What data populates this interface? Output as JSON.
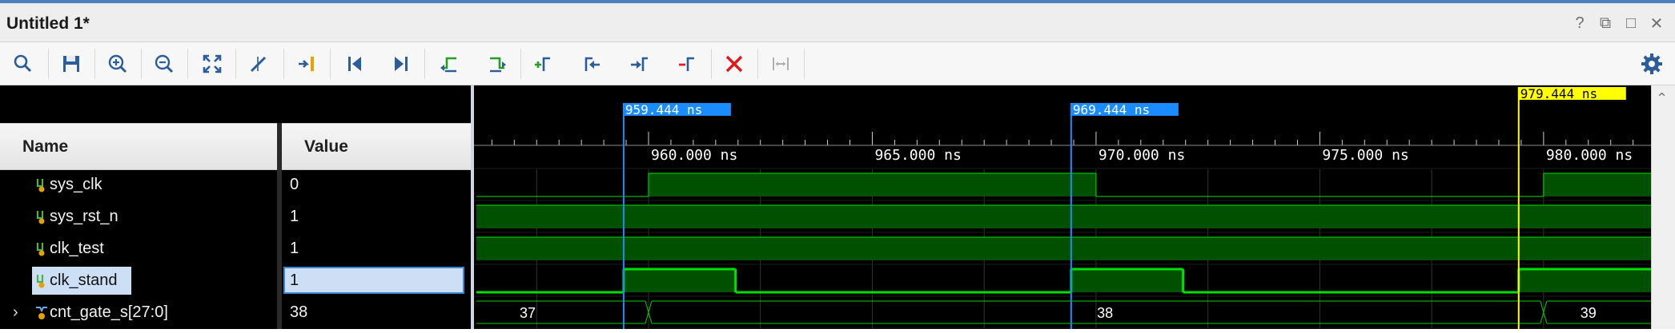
{
  "window": {
    "title": "Untitled 1*",
    "controls": [
      {
        "name": "help-icon",
        "glyph": "?"
      },
      {
        "name": "restore-icon",
        "glyph": "⧉"
      },
      {
        "name": "maximize-icon",
        "glyph": "□"
      },
      {
        "name": "close-icon",
        "glyph": "✕"
      }
    ]
  },
  "toolbar": {
    "buttons": [
      {
        "name": "search-icon"
      },
      {
        "name": "save-icon"
      },
      {
        "name": "zoom-in-icon"
      },
      {
        "name": "zoom-out-icon"
      },
      {
        "name": "zoom-fit-icon"
      },
      {
        "name": "cursor-snap-icon"
      },
      {
        "name": "goto-cursor-icon"
      },
      {
        "name": "goto-start-icon"
      },
      {
        "name": "goto-end-icon"
      },
      {
        "name": "prev-transition-icon"
      },
      {
        "name": "next-transition-icon"
      },
      {
        "name": "add-marker-icon"
      },
      {
        "name": "prev-marker-icon"
      },
      {
        "name": "next-marker-icon"
      },
      {
        "name": "remove-marker-icon"
      },
      {
        "name": "delete-icon"
      },
      {
        "name": "swap-cursors-icon"
      }
    ],
    "settings_icon": "gear-icon"
  },
  "columns": {
    "name": "Name",
    "value": "Value"
  },
  "signals": [
    {
      "name": "sys_clk",
      "value": "0",
      "type": "bit"
    },
    {
      "name": "sys_rst_n",
      "value": "1",
      "type": "bit"
    },
    {
      "name": "clk_test",
      "value": "1",
      "type": "bit"
    },
    {
      "name": "clk_stand",
      "value": "1",
      "type": "bit",
      "selected": true
    },
    {
      "name": "cnt_gate_s[27:0]",
      "value": "38",
      "type": "bus",
      "expandable": true
    }
  ],
  "waveform": {
    "cursors": [
      {
        "label": "959.444 ns",
        "time": 959.444,
        "color": "#1a8cff"
      },
      {
        "label": "969.444 ns",
        "time": 969.444,
        "color": "#1a8cff"
      },
      {
        "label": "979.444 ns",
        "time": 979.444,
        "color": "#ffff00"
      }
    ],
    "ticks": [
      {
        "label": "960.000 ns",
        "time": 960
      },
      {
        "label": "965.000 ns",
        "time": 965
      },
      {
        "label": "970.000 ns",
        "time": 970
      },
      {
        "label": "975.000 ns",
        "time": 975
      },
      {
        "label": "980.000 ns",
        "time": 980
      }
    ],
    "time_range": [
      956.1,
      982.4
    ],
    "bus_labels": [
      {
        "text": "37",
        "time": 957.3
      },
      {
        "text": "38",
        "time": 970.2
      },
      {
        "text": "39",
        "time": 981.0
      }
    ],
    "colors": {
      "high_fill": "#005000",
      "line": "#00e000",
      "bus_line": "#00d000",
      "grid": "#333333"
    }
  }
}
